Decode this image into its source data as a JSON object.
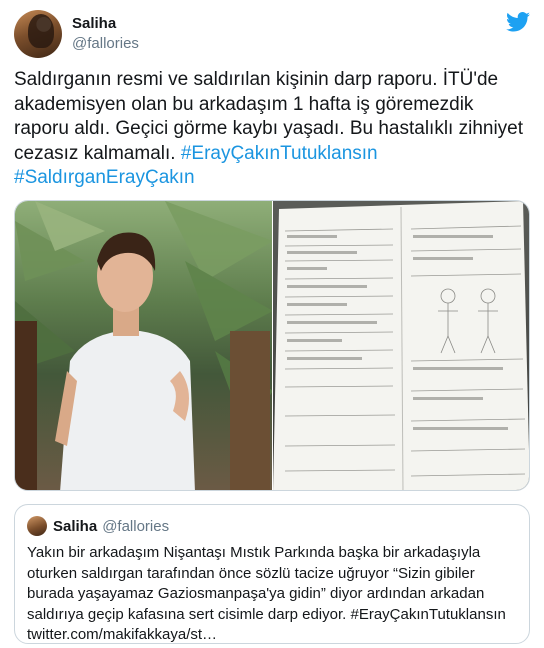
{
  "author": {
    "display_name": "Saliha",
    "handle": "@fallories"
  },
  "tweet": {
    "text": "Saldırganın resmi ve saldırılan kişinin darp raporu. İTÜ'de akademisyen olan bu arkadaşım 1 hafta iş göremezdik raporu aldı. Geçici görme kaybı yaşadı. Bu hastalıklı zihniyet cezasız kalmamalı.",
    "hashtag_1": "#ErayÇakınTutuklansın",
    "hashtag_2": "#SaldırganErayÇakın"
  },
  "media": {
    "photo_1": "photo of man in white t-shirt among palm leaves",
    "photo_2": "photo of medical assault report form"
  },
  "quote": {
    "display_name": "Saliha",
    "handle": "@fallories",
    "text": "Yakın bir arkadaşım Nişantaşı Mıstık Parkında başka bir arkadaşıyla oturken saldırgan tarafından önce sözlü tacize uğruyor “Sizin gibiler burada yaşayamaz Gaziosmanpaşa'ya gidin” diyor ardından arkadan saldırıya geçip kafasına sert cisimle darp ediyor. #ErayÇakınTutuklansın twitter.com/makifakkaya/st…"
  },
  "colors": {
    "hashtag": "#1b95e0",
    "twitter_bird": "#1da1f2",
    "secondary_text": "#657786",
    "border": "#ccd6dd"
  }
}
